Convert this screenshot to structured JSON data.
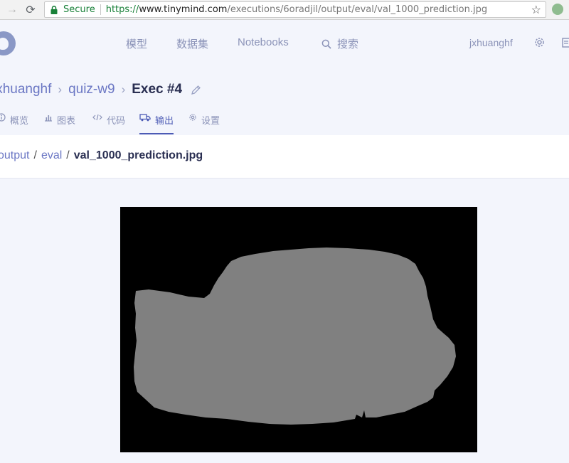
{
  "browser": {
    "secure_label": "Secure",
    "url_scheme": "https://",
    "url_host": "www.tinymind.com",
    "url_path": "/executions/6oradjil/output/eval/val_1000_prediction.jpg"
  },
  "nav": {
    "models": "模型",
    "datasets": "数据集",
    "notebooks": "Notebooks",
    "search": "搜索",
    "username": "jxhuanghf"
  },
  "breadcrumb": {
    "user": "jxhuanghf",
    "project": "quiz-w9",
    "current": "Exec #4"
  },
  "tabs": [
    {
      "label": "概览",
      "icon": "info-icon"
    },
    {
      "label": "图表",
      "icon": "bar-chart-icon"
    },
    {
      "label": "代码",
      "icon": "code-icon"
    },
    {
      "label": "输出",
      "icon": "truck-icon",
      "active": true
    },
    {
      "label": "设置",
      "icon": "gear-icon"
    }
  ],
  "file_path": {
    "segments": [
      "output",
      "eval"
    ],
    "file": "val_1000_prediction.jpg"
  },
  "preview": {
    "background_color": "#000000",
    "mask_color": "#808080"
  },
  "colors": {
    "accent": "#4c5bb5",
    "link": "#6b77c4",
    "muted": "#8b93b8",
    "page_bg": "#f3f5fc"
  }
}
